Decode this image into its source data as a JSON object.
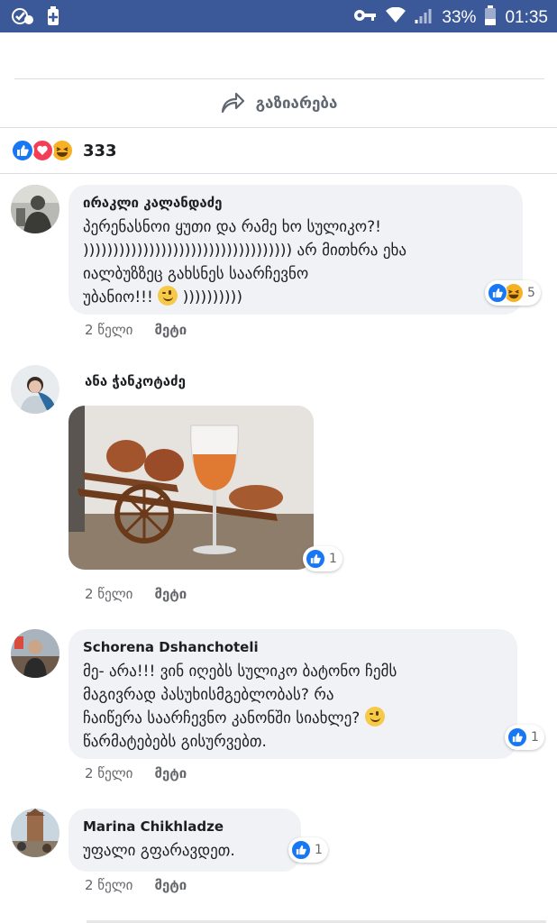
{
  "status_bar": {
    "battery_percent": "33%",
    "time": "01:35",
    "bg_color": "#3b5998"
  },
  "share": {
    "label": "გაზიარება",
    "icon": "share-arrow-icon"
  },
  "post_reactions": {
    "types": [
      "like",
      "love",
      "haha"
    ],
    "count": "333"
  },
  "comments": [
    {
      "author": "ირაკლი კალანდაძე",
      "text_lines": [
        "პერენასნოი ყუთი და რამე ხო სულიკო?!",
        "))))))))))))))))))))))))))))))))))) არ მითხრა ეხა",
        "იალბუზზეც გახსნეს საარჩევნო",
        "უბანიო!!!"
      ],
      "text_tail": " ))))))))))",
      "reactions": {
        "types": [
          "like",
          "haha"
        ],
        "count": "5"
      },
      "age": "2 წელი",
      "more": "მეტი"
    },
    {
      "author": "ანა ჭანკოტაძე",
      "reactions": {
        "types": [
          "like"
        ],
        "count": "1"
      },
      "age": "2 წელი",
      "more": "მეტი"
    },
    {
      "author": "Schorena Dshanchoteli",
      "text_lines": [
        "მე- არა!!! ვინ იღებს სულიკო ბატონო ჩემს",
        "მაგივრად პასუხისმგებლობას? რა",
        "ჩაიწერა საარჩევნო კანონში სიახლე?",
        "წარმატებებს გისურვებთ."
      ],
      "reactions": {
        "types": [
          "like"
        ],
        "count": "1"
      },
      "age": "2 წელი",
      "more": "მეტი"
    },
    {
      "author": "Marina Chikhladze",
      "text_lines": [
        "უფალი გფარავდეთ."
      ],
      "reactions": {
        "types": [
          "like"
        ],
        "count": "1"
      },
      "age": "2 წელი",
      "more": "მეტი"
    }
  ]
}
